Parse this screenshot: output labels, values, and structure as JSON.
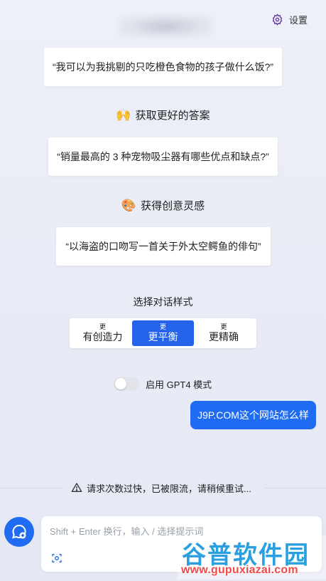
{
  "header": {
    "settings_label": "设置"
  },
  "examples": {
    "card1": "“我可以为我挑剔的只吃橙色食物的孩子做什么饭?”",
    "section2_title": "获取更好的答案",
    "section2_emoji": "🙌",
    "card2": "“销量最高的 3 种宠物吸尘器有哪些优点和缺点?”",
    "section3_title": "获得创意灵感",
    "section3_emoji": "🎨",
    "card3": "“以海盗的口吻写一首关于外太空鳄鱼的俳句”"
  },
  "conversation_style": {
    "label": "选择对话样式",
    "options": [
      {
        "small": "更",
        "big": "有创造力",
        "active": false
      },
      {
        "small": "更",
        "big": "更平衡",
        "active": true
      },
      {
        "small": "更",
        "big": "更精确",
        "active": false
      }
    ]
  },
  "gpt4_toggle": {
    "label": "启用 GPT4 模式",
    "enabled": false
  },
  "chat": {
    "user_message": "J9P.COM这个网站怎么样"
  },
  "status": {
    "warning": "请求次数过快，已被限流，请稍候重试..."
  },
  "composer": {
    "placeholder": "Shift + Enter 换行，输入 / 选择提示词"
  },
  "watermark": {
    "title": "谷普软件园",
    "url": "www.gupuxiazai.com"
  },
  "colors": {
    "accent": "#1f6bf1",
    "active_segment": "#2563eb",
    "settings_icon": "#6b3fa0"
  }
}
